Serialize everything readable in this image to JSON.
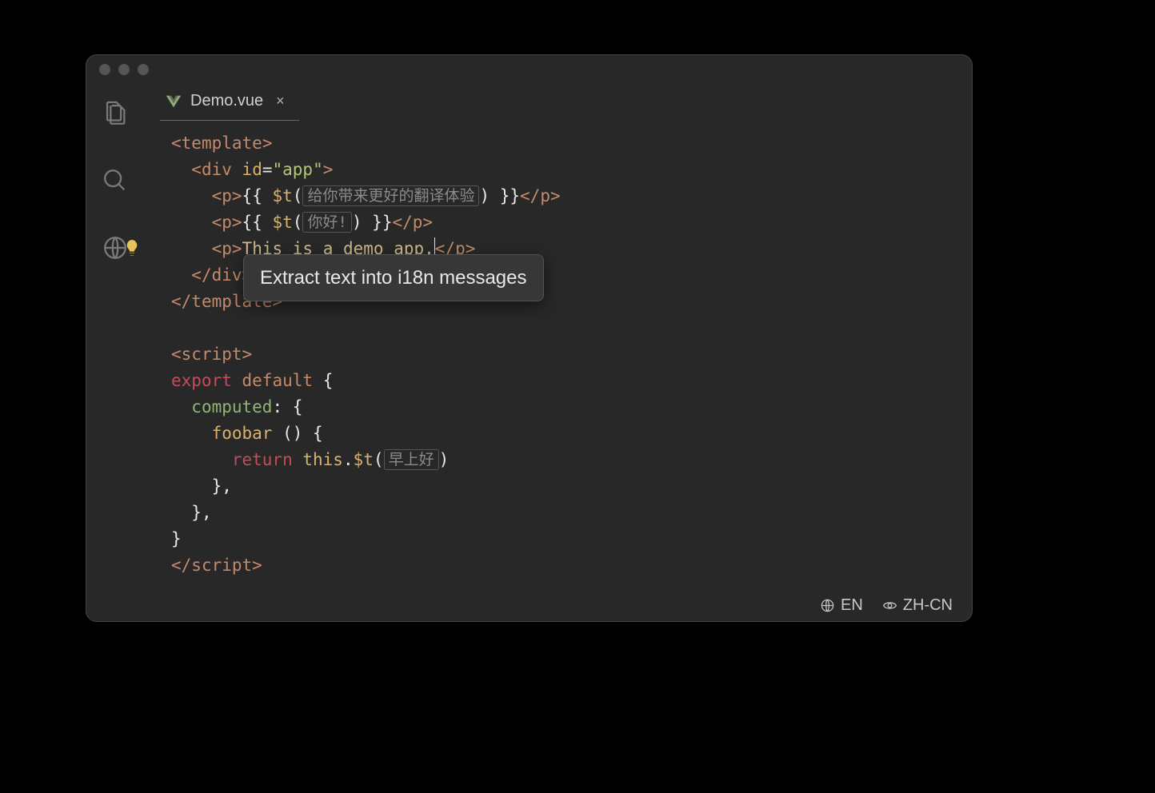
{
  "tab": {
    "filename": "Demo.vue",
    "close_glyph": "×"
  },
  "code": {
    "t_hint1": "给你带来更好的翻译体验",
    "t_hint2": "你好!",
    "plain_text": "This is a demo app.",
    "t_hint3": "早上好",
    "kw_export": "export",
    "kw_default": "default",
    "kw_computed": "computed",
    "fn_name": "foobar",
    "kw_return": "return",
    "kw_this": "this",
    "template_tag": "template",
    "div_tag": "div",
    "p_tag": "p",
    "script_tag": "script",
    "id_attr": "id",
    "id_val": "\"app\"",
    "t_fn": "$t"
  },
  "quickfix": {
    "label": "Extract text into i18n messages"
  },
  "statusbar": {
    "source_lang": "EN",
    "display_lang": "ZH-CN"
  },
  "colors": {
    "background": "#282828",
    "tag": "#c48a6a",
    "attr": "#d8b26d",
    "string": "#b3c77a",
    "keyword_red": "#c54b5e",
    "hint_text": "#8a8a8a"
  }
}
